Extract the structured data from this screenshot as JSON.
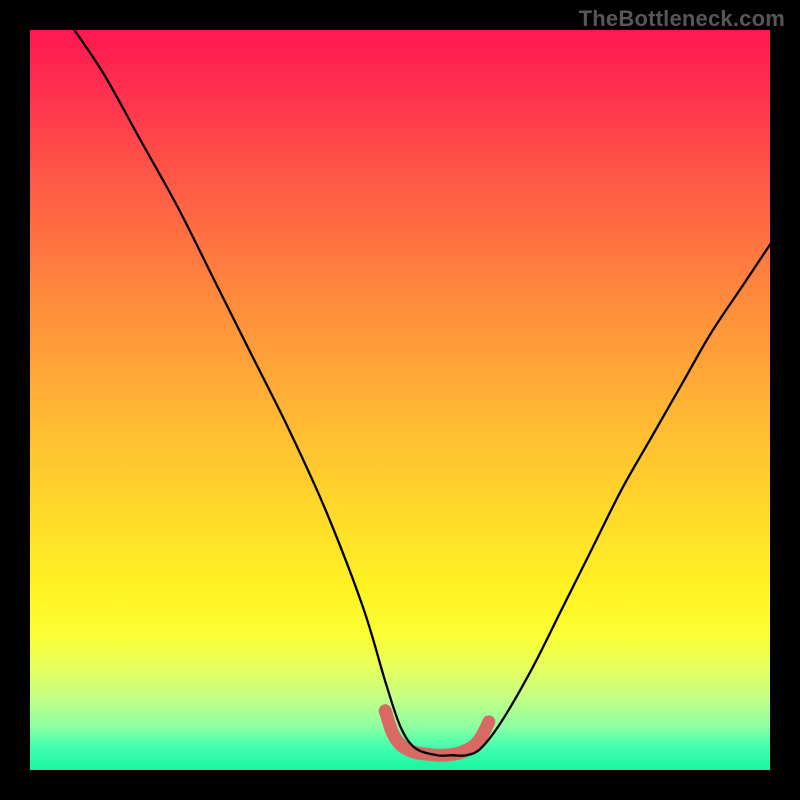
{
  "watermark": "TheBottleneck.com",
  "chart_data": {
    "type": "line",
    "title": "",
    "xlabel": "",
    "ylabel": "",
    "xlim": [
      0,
      100
    ],
    "ylim": [
      0,
      100
    ],
    "series": [
      {
        "name": "main-curve",
        "color": "#000000",
        "x": [
          6,
          10,
          15,
          20,
          25,
          30,
          35,
          40,
          45,
          48,
          50,
          52,
          55,
          57,
          59,
          61,
          64,
          68,
          72,
          76,
          80,
          84,
          88,
          92,
          96,
          100
        ],
        "y": [
          100,
          94,
          85,
          76,
          66,
          56,
          46,
          35,
          22,
          12,
          6,
          3,
          2,
          2,
          2,
          3,
          7,
          14,
          22,
          30,
          38,
          45,
          52,
          59,
          65,
          71
        ]
      },
      {
        "name": "valley-marker",
        "color": "#d96a63",
        "x": [
          48,
          49,
          50,
          51,
          52,
          53,
          54,
          55,
          56,
          57,
          58,
          59,
          60,
          61,
          62
        ],
        "y": [
          8,
          5,
          3.5,
          2.8,
          2.4,
          2.2,
          2.1,
          2.0,
          2.0,
          2.1,
          2.3,
          2.7,
          3.3,
          4.5,
          6.5
        ]
      }
    ],
    "gradient_stops": [
      {
        "pos": 0,
        "color": "#ff1850"
      },
      {
        "pos": 8,
        "color": "#ff2f4f"
      },
      {
        "pos": 20,
        "color": "#ff5846"
      },
      {
        "pos": 32,
        "color": "#ff7d3f"
      },
      {
        "pos": 45,
        "color": "#ffa338"
      },
      {
        "pos": 56,
        "color": "#ffc230"
      },
      {
        "pos": 68,
        "color": "#ffe028"
      },
      {
        "pos": 76,
        "color": "#fff423"
      },
      {
        "pos": 82,
        "color": "#fbff35"
      },
      {
        "pos": 86,
        "color": "#e7ff5c"
      },
      {
        "pos": 90,
        "color": "#c6ff82"
      },
      {
        "pos": 94,
        "color": "#8fffa0"
      },
      {
        "pos": 97,
        "color": "#41ffb0"
      },
      {
        "pos": 100,
        "color": "#17f6a0"
      }
    ]
  }
}
